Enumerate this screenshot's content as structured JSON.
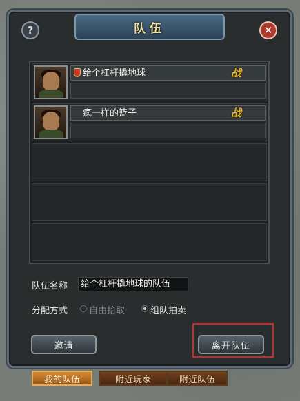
{
  "window": {
    "title": "队伍",
    "help_label": "?",
    "close_label": "✕"
  },
  "members": [
    {
      "name": "给个杠杆撬地球",
      "role": "战",
      "leader": true
    },
    {
      "name": "疯一样的篮子",
      "role": "战",
      "leader": false
    }
  ],
  "form": {
    "team_name_label": "队伍名称",
    "team_name_value": "给个杠杆撬地球的队伍",
    "distribution_label": "分配方式",
    "options": [
      {
        "label": "自由拾取",
        "selected": false
      },
      {
        "label": "组队拍卖",
        "selected": true
      }
    ]
  },
  "buttons": {
    "invite": "邀请",
    "leave": "离开队伍"
  },
  "tabs": [
    {
      "label": "我的队伍",
      "active": true
    },
    {
      "label": "附近玩家",
      "active": false
    },
    {
      "label": "附近队伍",
      "active": false
    }
  ],
  "colors": {
    "title_text": "#f3dd9a",
    "role_text": "#e8b82c",
    "highlight_border": "#d1272a",
    "active_tab": "#d58a32"
  }
}
